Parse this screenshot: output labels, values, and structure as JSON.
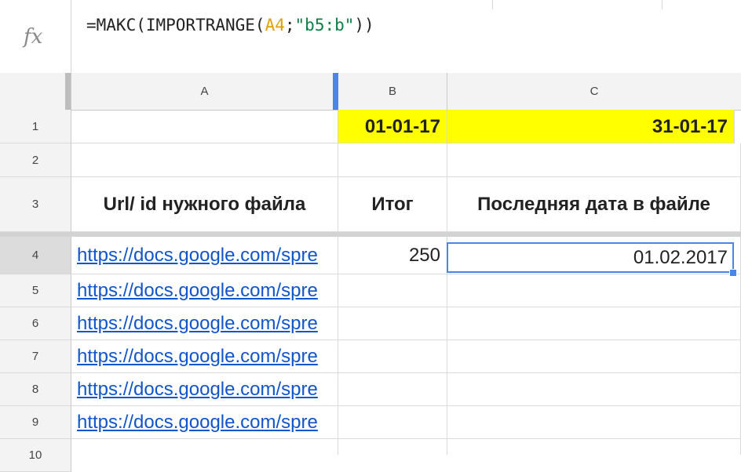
{
  "formula_bar": {
    "icon": "fx",
    "formula_prefix": "=МАКС(IMPORTRANGE(",
    "formula_ref": "A4",
    "formula_sep": ";",
    "formula_str": "\"b5:b\"",
    "formula_suffix": "))"
  },
  "columns": [
    "A",
    "B",
    "C"
  ],
  "rows": [
    "1",
    "2",
    "3",
    "4",
    "5",
    "6",
    "7",
    "8",
    "9",
    "10"
  ],
  "cells": {
    "b1": "01-01-17",
    "c1": "31-01-17",
    "a3": "Url/ id нужного файла",
    "b3": "Итог",
    "c3": "Последняя дата в файле",
    "b4": "250",
    "c4": "01.02.2017",
    "links": [
      "https://docs.google.com/spre",
      "https://docs.google.com/spre",
      "https://docs.google.com/spre",
      "https://docs.google.com/spre",
      "https://docs.google.com/spre",
      "https://docs.google.com/spre"
    ]
  },
  "colors": {
    "highlight": "#ffff00",
    "link": "#1155cc",
    "selection": "#4a86e8",
    "ref_color": "#e0a000",
    "string_color": "#0b8043"
  }
}
